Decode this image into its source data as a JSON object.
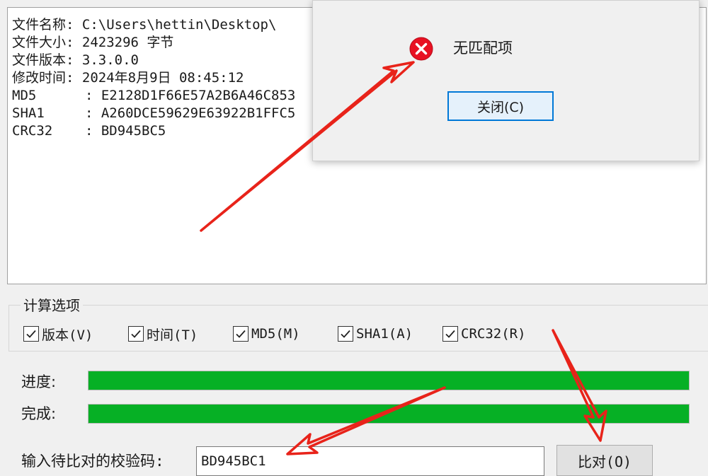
{
  "result_panel": {
    "lines": [
      "文件名称: C:\\Users\\hettin\\Desktop\\",
      "文件大小: 2423296 字节",
      "文件版本: 3.3.0.0",
      "修改时间: 2024年8月9日 08:45:12",
      "MD5      : E2128D1F66E57A2B6A46C853",
      "SHA1     : A260DCE59629E63922B1FFC5",
      "CRC32    : BD945BC5"
    ]
  },
  "options": {
    "title": "计算选项",
    "checkboxes": [
      {
        "label": "版本(V)",
        "checked": true
      },
      {
        "label": "时间(T)",
        "checked": true
      },
      {
        "label": "MD5(M)",
        "checked": true
      },
      {
        "label": "SHA1(A)",
        "checked": true
      },
      {
        "label": "CRC32(R)",
        "checked": true
      }
    ]
  },
  "progress": {
    "progress_label": "进度:",
    "progress_value": 1.0,
    "complete_label": "完成:",
    "complete_value": 1.0,
    "fill_color": "#06b025"
  },
  "compare": {
    "input_label": "输入待比对的校验码:",
    "input_value": "BD945BC1",
    "button_label": "比对(O)"
  },
  "dialog": {
    "icon": "error-icon",
    "message": "无匹配项",
    "close_label": "关闭(C)"
  },
  "colors": {
    "error": "#e81123",
    "annotation_arrow": "#e8231a",
    "focus": "#0078d7"
  }
}
